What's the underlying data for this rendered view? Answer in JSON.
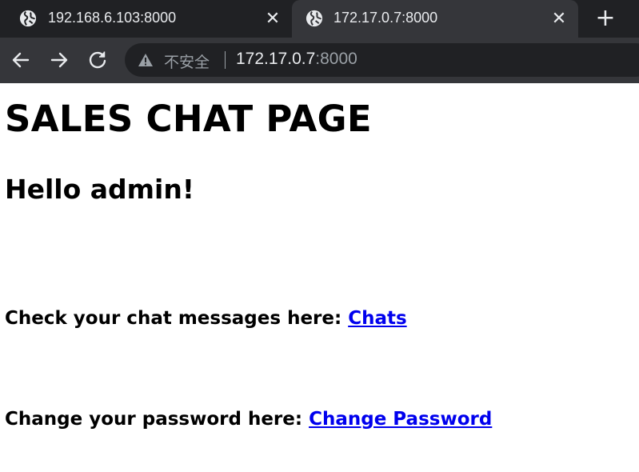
{
  "browser": {
    "tabs": [
      {
        "title": "192.168.6.103:8000",
        "active": false,
        "icon": "globe-icon"
      },
      {
        "title": "172.17.0.7:8000",
        "active": true,
        "icon": "globe-icon"
      }
    ],
    "close_glyph": "✕",
    "new_tab_glyph": "+",
    "security_label": "不安全",
    "url_host": "172.17.0.7",
    "url_port": ":8000",
    "colors": {
      "tabstrip": "#202124",
      "toolbar": "#35363a",
      "omnibox": "#202124",
      "text": "#e8eaed",
      "muted": "#9aa0a6"
    }
  },
  "page": {
    "heading": "SALES CHAT PAGE",
    "greeting": "Hello admin!",
    "chats_prompt": "Check your chat messages here: ",
    "chats_link": "Chats",
    "password_prompt": "Change your password here: ",
    "password_link": "Change Password",
    "link_color": "#0000ee"
  }
}
